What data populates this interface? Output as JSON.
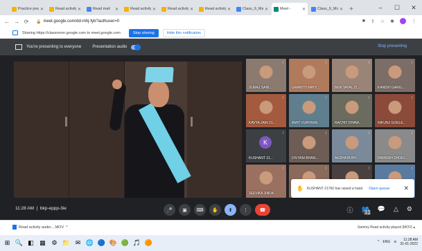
{
  "browser": {
    "tabs": [
      {
        "label": "Practice prep",
        "color": "#f4b400",
        "active": false
      },
      {
        "label": "Read activity w",
        "color": "#f4b400",
        "active": false
      },
      {
        "label": "Read mail",
        "color": "#4285f4",
        "active": false
      },
      {
        "label": "Read activity p",
        "color": "#f4b400",
        "active": false
      },
      {
        "label": "Read activity p",
        "color": "#f4b400",
        "active": false
      },
      {
        "label": "Read activity in",
        "color": "#f4b400",
        "active": false
      },
      {
        "label": "Class_9_Math",
        "color": "#4285f4",
        "active": false
      },
      {
        "label": "Meet - ",
        "color": "#00897b",
        "active": true
      },
      {
        "label": "Class_9_Mon",
        "color": "#4285f4",
        "active": false
      }
    ],
    "new_tab": "+",
    "url": "meet.google.com/dd-mhj-fyb?authuser=0",
    "window_controls": [
      "–",
      "☐",
      "✕"
    ]
  },
  "share_notice": {
    "text": "Sharing https://classroom.google.com to meet.google.com",
    "stop_button": "Stop sharing",
    "hide_button": "Hide this notification"
  },
  "meet": {
    "presenting_text": "You're presenting to everyone",
    "presentation_audio": "Presentation audio",
    "stop_presenting": "Stop presenting",
    "participants": [
      {
        "name": "SURAJ SAIN...",
        "bg": "#8a7a6f"
      },
      {
        "name": "GRANTTI NAYY...",
        "bg": "#b07a5c"
      },
      {
        "name": "BEN TAYAL 21...",
        "bg": "#9a8377"
      },
      {
        "name": "KANISH GARG...",
        "bg": "#7c6e66"
      },
      {
        "name": "KAVYA JAIN 21...",
        "bg": "#a45a3e"
      },
      {
        "name": "AMIT VIJAYRAN",
        "bg": "#5f7f8f"
      },
      {
        "name": "RACHIT DHAW...",
        "bg": "#6b6b5f"
      },
      {
        "name": "NIKUNJ GOELE...",
        "bg": "#8b4a3a"
      },
      {
        "name": "KUSHANT 21...",
        "bg": "#3c4043",
        "avatar": "K"
      },
      {
        "name": "DIVYAM BHAN...",
        "bg": "#6d5d55"
      },
      {
        "name": "AKSHAYA BH...",
        "bg": "#7a8a9a"
      },
      {
        "name": "PARNISH SHOKI...",
        "bg": "#8a8a8a"
      },
      {
        "name": "JEEVIKA JINDA...",
        "bg": "#9a7060"
      },
      {
        "name": "",
        "bg": "#8a6a5a"
      },
      {
        "name": "",
        "bg": "#4a4040"
      },
      {
        "name": "",
        "bg": "#5a7aa0"
      }
    ],
    "hand_raised": {
      "text": "KUSHANT 21760 has raised a hand",
      "open_queue": "Open queue",
      "close": "✕"
    },
    "clock": "11:28 AM",
    "meeting_code": "bkp-eppp-3ie",
    "controls": [
      "🎤",
      "▣",
      "⌨",
      "✋",
      "⬆",
      "⋮",
      "☎"
    ],
    "right_controls": [
      "ⓘ",
      "👥",
      "💬",
      "△",
      "⚙"
    ],
    "people_count": "31"
  },
  "download": {
    "file": "Read activity audio....MOV",
    "right_text": "Sammy Read activity played (MOV) ▴"
  },
  "taskbar": {
    "icons": [
      "⊞",
      "🔍",
      "◧",
      "▦",
      "⚙",
      "📁",
      "✉",
      "🌐",
      "🔵",
      "🎨",
      "🟢",
      "🎵",
      "🟠"
    ],
    "tray": "ENG",
    "time": "11:28 AM",
    "date": "31-01-2022"
  }
}
